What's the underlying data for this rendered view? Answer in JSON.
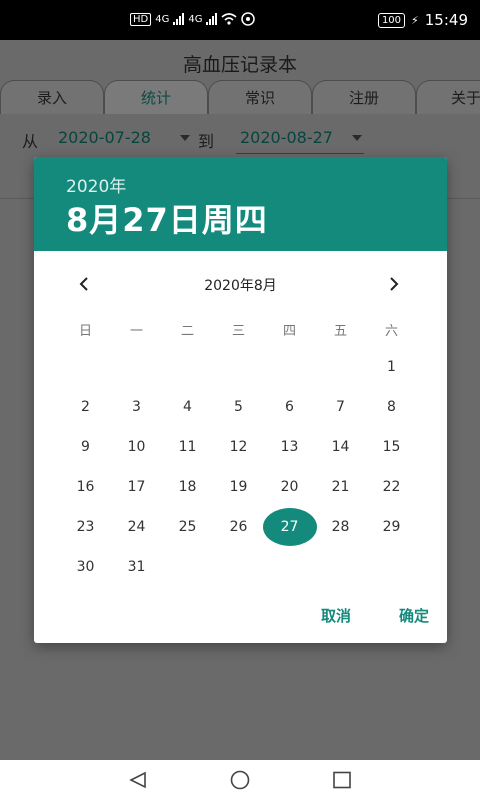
{
  "status_bar": {
    "left_badges": [
      "HD",
      "4G",
      "4G"
    ],
    "battery": "100",
    "time": "15:49"
  },
  "app": {
    "title": "高血压记录本",
    "tabs": [
      "录入",
      "统计",
      "常识",
      "注册",
      "关于"
    ],
    "active_tab_index": 1,
    "filter": {
      "from_label": "从",
      "from_date": "2020-07-28",
      "to_label": "到",
      "to_date": "2020-08-27"
    }
  },
  "dialog": {
    "year": "2020年",
    "selected_date_text": "8月27日周四",
    "month_label": "2020年8月",
    "weekdays": [
      "日",
      "一",
      "二",
      "三",
      "四",
      "五",
      "六"
    ],
    "first_weekday_index": 6,
    "days_in_month": 31,
    "selected_day": 27,
    "cancel_label": "取消",
    "ok_label": "确定",
    "accent_color": "#148a7c"
  },
  "colors": {
    "accent": "#148a7c",
    "scrim": "#6a6a6a"
  }
}
